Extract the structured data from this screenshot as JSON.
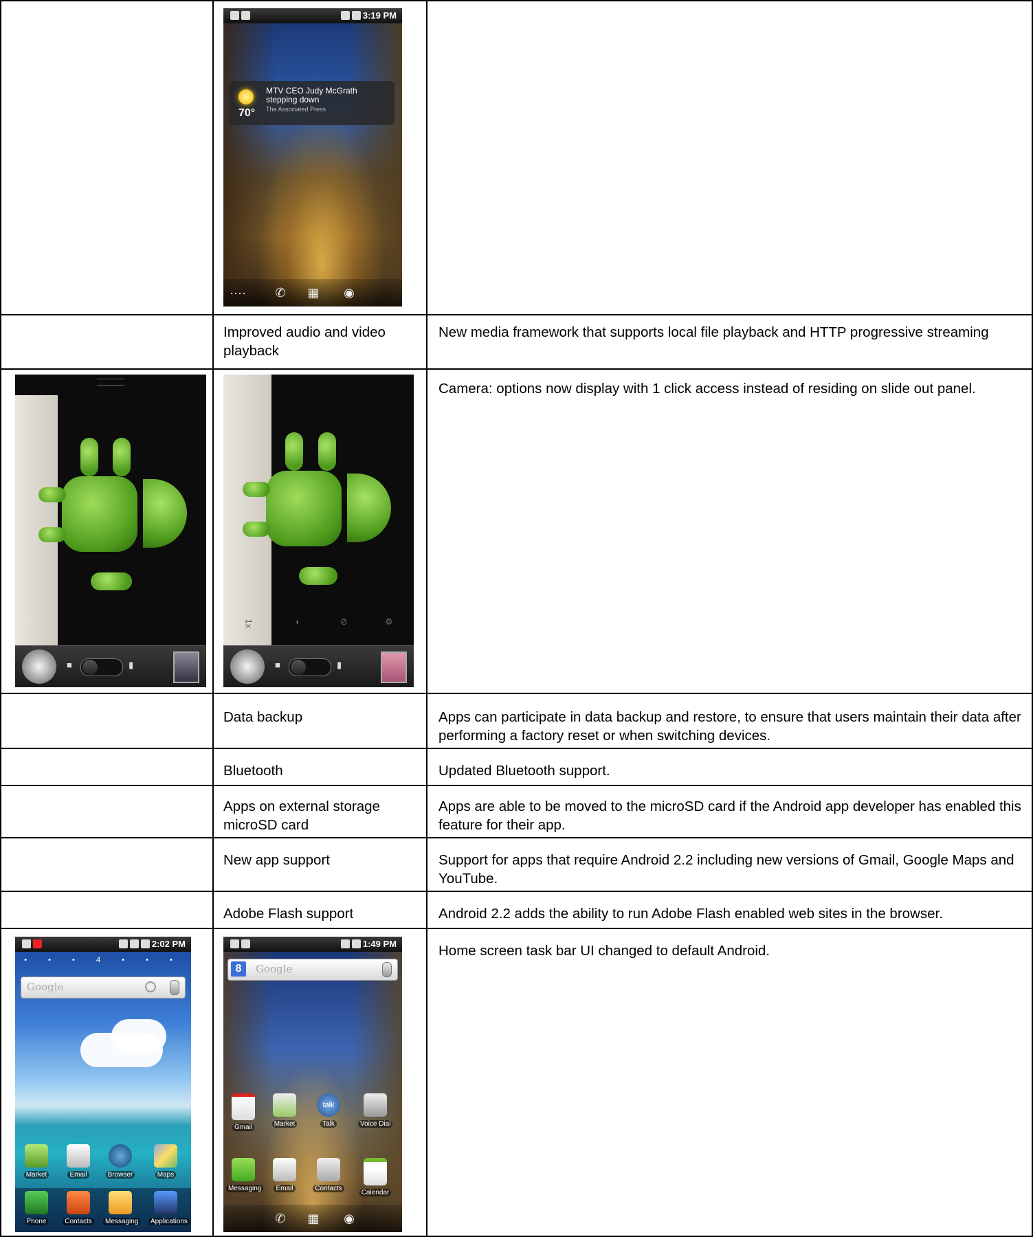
{
  "rows": [
    {
      "feature": "",
      "description": "",
      "phone_after": {
        "status_time": "3:19 PM",
        "widget": {
          "temperature": "70°",
          "headline": "MTV CEO Judy McGrath stepping down",
          "source": "The Associated Press"
        },
        "dock_icons": [
          "dots-icon",
          "phone-icon",
          "apps-grid-icon",
          "browser-icon"
        ]
      }
    },
    {
      "feature": "Improved audio and video playback",
      "description": "New media framework that supports local file playback and HTTP progressive streaming"
    },
    {
      "feature": "",
      "description": "Camera:  options now display with 1 click access instead of residing on slide out panel.",
      "camera_before": {
        "controls": [
          "shutter-icon",
          "camera-mode-icon",
          "mode-toggle",
          "camcorder-icon",
          "gallery-thumbnail"
        ]
      },
      "camera_after": {
        "options": [
          "1x",
          "auto-focus-icon",
          "flash-icon",
          "settings-icon"
        ],
        "controls": [
          "shutter-icon",
          "camera-mode-icon",
          "mode-toggle",
          "camcorder-icon",
          "gallery-thumbnail"
        ]
      }
    },
    {
      "feature": "Data backup",
      "description": "Apps can participate in data backup and restore, to ensure that users maintain their data after performing a factory reset or when switching devices."
    },
    {
      "feature": "Bluetooth",
      "description": "Updated Bluetooth support."
    },
    {
      "feature": "Apps on external storage microSD card",
      "description": "Apps are able to be moved to the microSD card if the Android app developer has enabled this feature for their app."
    },
    {
      "feature": "New app support",
      "description": "Support for apps that require Android 2.2 including new versions of Gmail, Google Maps and YouTube."
    },
    {
      "feature": "Adobe Flash support",
      "description": "Android 2.2 adds the ability to run Adobe Flash enabled web sites in the browser."
    },
    {
      "feature": "",
      "description": "Home screen task bar UI changed to default Android.",
      "home_before": {
        "status_time": "2:02 PM",
        "page_indicator": "4",
        "search_placeholder": "Google",
        "apps_row1": [
          "Market",
          "Email",
          "Browser",
          "Maps"
        ],
        "dock": [
          "Phone",
          "Contacts",
          "Messaging",
          "Applications"
        ]
      },
      "home_after": {
        "status_time": "1:49 PM",
        "search_placeholder": "Google",
        "apps_row1": [
          "Gmail",
          "Market",
          "Talk",
          "Voice Dial"
        ],
        "apps_row2": [
          "Messaging",
          "Email",
          "Contacts",
          "Calendar"
        ],
        "talk_badge": "talk"
      }
    }
  ],
  "colors": {
    "grid": "#000000",
    "droid_green": "#6fba2c",
    "google_blue": "#3b6fd8"
  }
}
